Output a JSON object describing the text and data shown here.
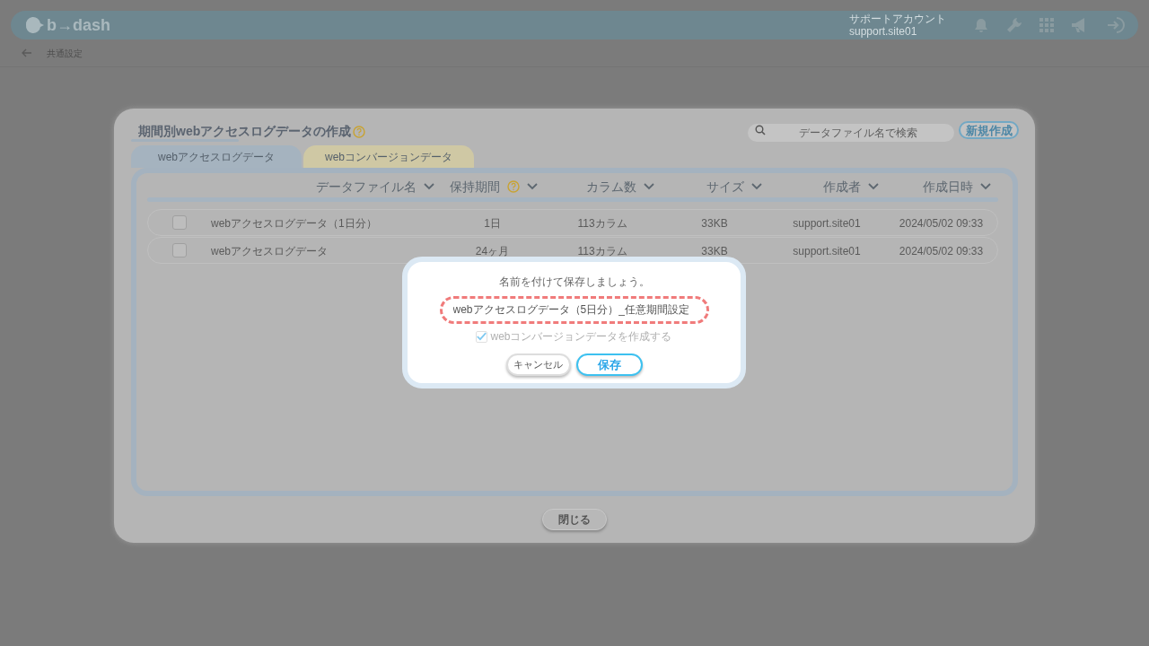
{
  "header": {
    "logo": "b→dash",
    "account_label": "サポートアカウント",
    "account_id": "support.site01"
  },
  "breadcrumb": {
    "label": "共通設定"
  },
  "modal": {
    "title": "期間別webアクセスログデータの作成",
    "search": {
      "placeholder": "データファイル名で検索"
    },
    "new_button": "新規作成",
    "tabs": [
      {
        "label": "webアクセスログデータ",
        "selected": true
      },
      {
        "label": "webコンバージョンデータ",
        "selected": false
      }
    ],
    "table": {
      "columns": [
        {
          "label": "データファイル名",
          "help": false
        },
        {
          "label": "保持期間",
          "help": true
        },
        {
          "label": "カラム数",
          "help": false
        },
        {
          "label": "サイズ",
          "help": false
        },
        {
          "label": "作成者",
          "help": false
        },
        {
          "label": "作成日時",
          "help": false
        }
      ],
      "rows": [
        {
          "checked": false,
          "cells": [
            "webアクセスログデータ（1日分）",
            "1日",
            "113カラム",
            "33KB",
            "support.site01",
            "2024/05/02 09:33"
          ]
        },
        {
          "checked": false,
          "cells": [
            "webアクセスログデータ",
            "24ヶ月",
            "113カラム",
            "33KB",
            "support.site01",
            "2024/05/02 09:33"
          ]
        }
      ]
    },
    "close_button": "閉じる"
  },
  "dialog": {
    "prompt": "名前を付けて保存しましょう。",
    "name_field": {
      "value": "webアクセスログデータ（5日分）_任意期間設定"
    },
    "option": {
      "label": "webコンバージョンデータを作成する",
      "checked": true,
      "disabled": true
    },
    "cancel_button": "キャンセル",
    "save_button": "保存"
  }
}
